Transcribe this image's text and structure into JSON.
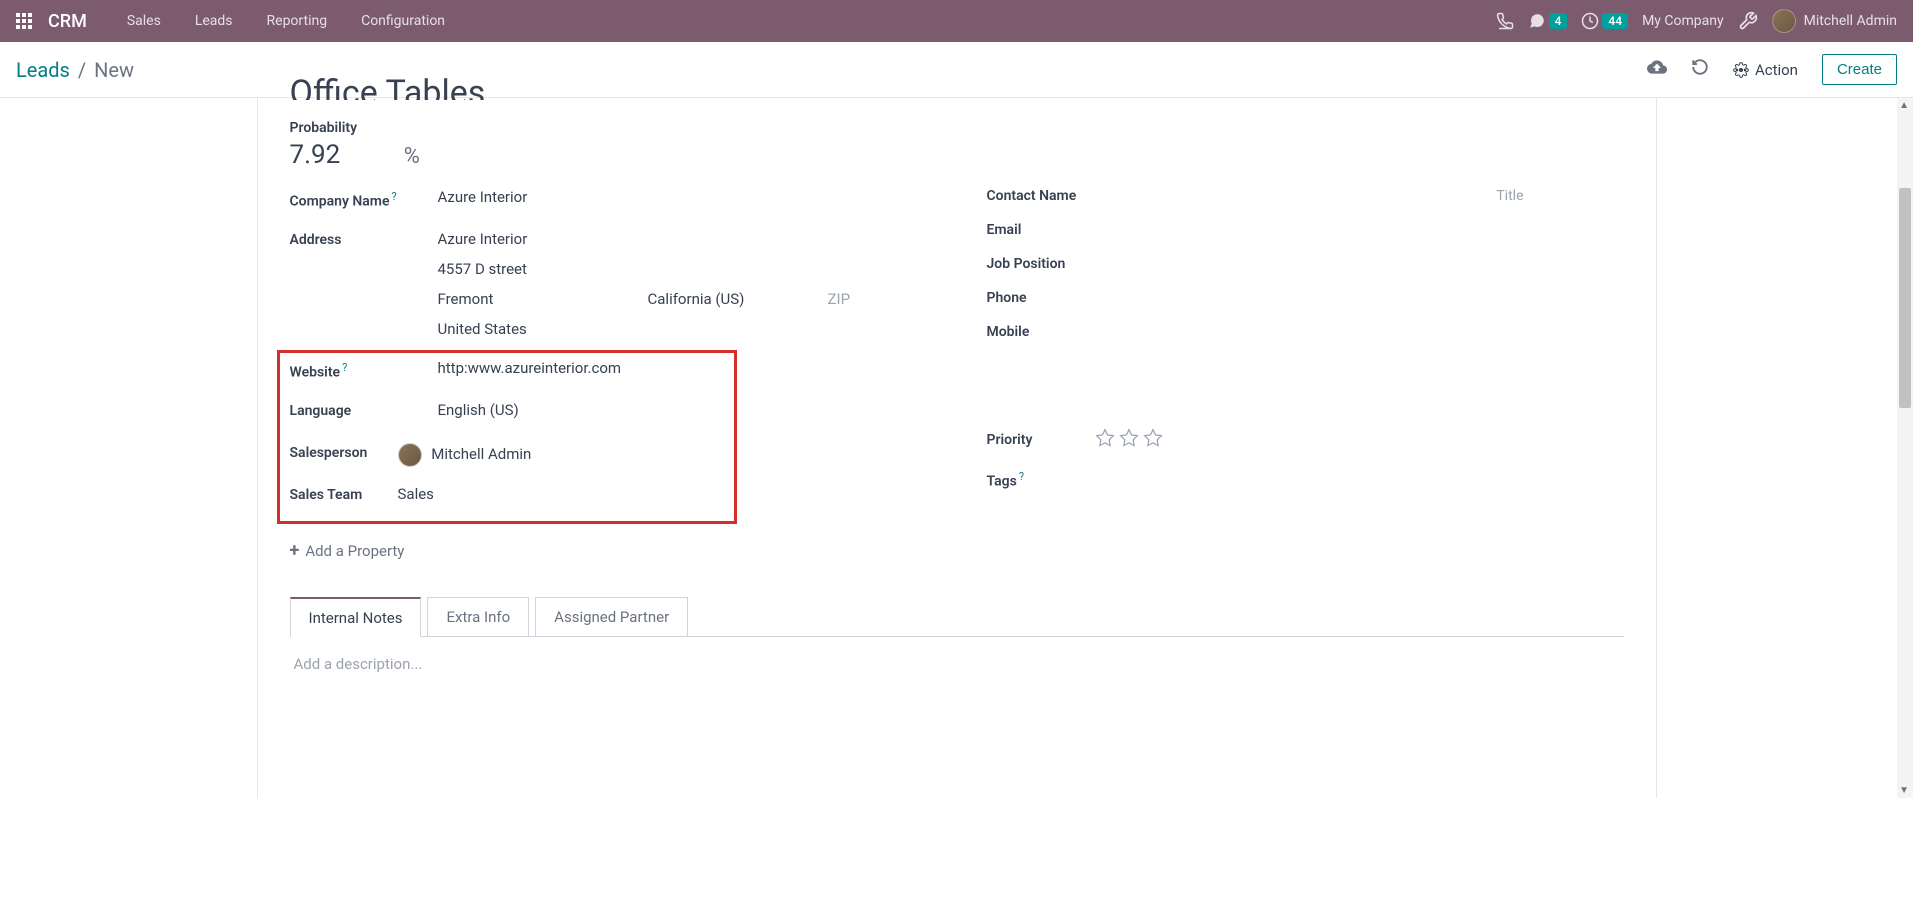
{
  "nav": {
    "brand": "CRM",
    "items": [
      "Sales",
      "Leads",
      "Reporting",
      "Configuration"
    ],
    "messages_badge": "4",
    "activities_badge": "44",
    "company": "My Company",
    "user": "Mitchell Admin"
  },
  "breadcrumb": {
    "parent": "Leads",
    "separator": "/",
    "current": "New"
  },
  "actions": {
    "action_label": "Action",
    "create_label": "Create"
  },
  "form": {
    "title_cut": "Office Tables",
    "probability_label": "Probability",
    "probability_value": "7.92",
    "percent_symbol": "%",
    "company_name_label": "Company Name",
    "company_name_value": "Azure Interior",
    "address_label": "Address",
    "address": {
      "line1": "Azure Interior",
      "line2": "4557 D street",
      "city": "Fremont",
      "state": "California (US)",
      "zip_placeholder": "ZIP",
      "country": "United States"
    },
    "website_label": "Website",
    "website_value": "http:www.azureinterior.com",
    "language_label": "Language",
    "language_value": "English (US)",
    "salesperson_label": "Salesperson",
    "salesperson_value": "Mitchell Admin",
    "sales_team_label": "Sales Team",
    "sales_team_value": "Sales",
    "add_property_label": "Add a Property",
    "contact_name_label": "Contact Name",
    "title_placeholder": "Title",
    "email_label": "Email",
    "job_position_label": "Job Position",
    "phone_label": "Phone",
    "mobile_label": "Mobile",
    "priority_label": "Priority",
    "tags_label": "Tags",
    "help_symbol": "?"
  },
  "tabs": {
    "internal_notes": "Internal Notes",
    "extra_info": "Extra Info",
    "assigned_partner": "Assigned Partner",
    "description_placeholder": "Add a description..."
  }
}
